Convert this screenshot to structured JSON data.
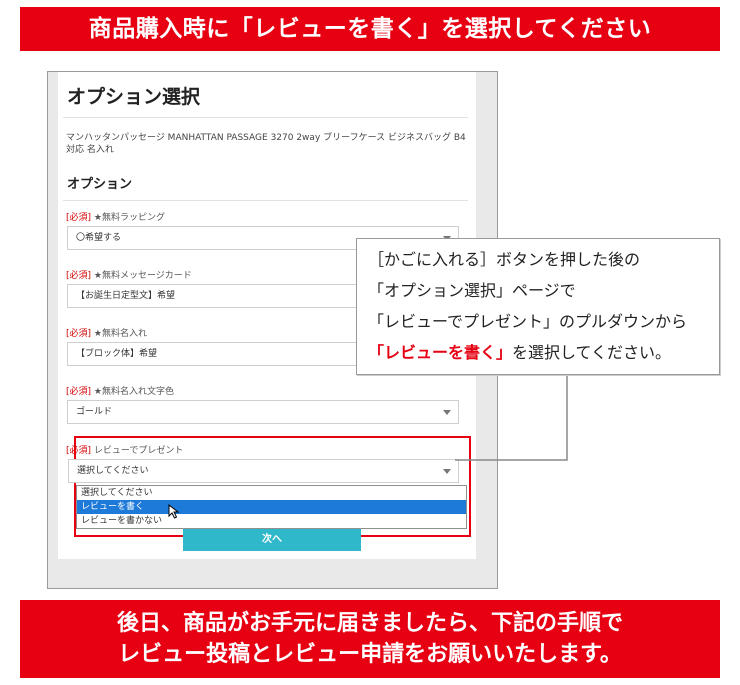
{
  "top_banner": {
    "text": "商品購入時に「レビューを書く」を選択してください"
  },
  "screenshot": {
    "title": "オプション選択",
    "product_name": "マンハッタンパッセージ MANHATTAN PASSAGE 3270 2way ブリーフケース ビジネスバッグ B4対応 名入れ",
    "options_heading": "オプション",
    "fields": [
      {
        "required": "[必須]",
        "label": "★無料ラッピング",
        "value": "〇希望する"
      },
      {
        "required": "[必須]",
        "label": "★無料メッセージカード",
        "value": "【お誕生日定型文】希望"
      },
      {
        "required": "[必須]",
        "label": "★無料名入れ",
        "value": "【ブロック体】希望"
      },
      {
        "required": "[必須]",
        "label": "★無料名入れ文字色",
        "value": "ゴールド"
      },
      {
        "required": "[必須]",
        "label": "レビューでプレゼント",
        "value": "選択してください"
      }
    ],
    "dropdown_options": [
      "選択してください",
      "レビューを書く",
      "レビューを書かない"
    ],
    "dropdown_selected_index": 1,
    "next_button": "次へ"
  },
  "callout": {
    "line1": "［かごに入れる］ボタンを押した後の",
    "line2": "「オプション選択」ページで",
    "line3": "「レビューでプレゼント」のプルダウンから",
    "line4_emph": "「レビューを書く」",
    "line4_rest": "を選択してください。"
  },
  "bottom_banner": {
    "line1": "後日、商品がお手元に届きましたら、下記の手順で",
    "line2": "レビュー投稿とレビュー申請をお願いいたします。"
  },
  "colors": {
    "brand_red": "#e60012",
    "button_teal": "#2fb8c9",
    "selected_blue": "#1e7ad8"
  },
  "icons": [
    "select-arrow-icon",
    "mouse-cursor-icon"
  ]
}
